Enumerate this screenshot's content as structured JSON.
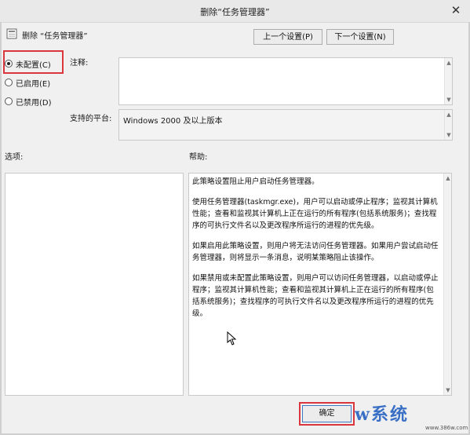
{
  "window": {
    "title": "删除“任务管理器”",
    "close_glyph": "✕"
  },
  "header": {
    "setting_title": "删除 “任务管理器”",
    "prev_button": "上一个设置(P)",
    "next_button": "下一个设置(N)"
  },
  "state": {
    "options": [
      {
        "label": "未配置(C)",
        "checked": true
      },
      {
        "label": "已启用(E)",
        "checked": false
      },
      {
        "label": "已禁用(D)",
        "checked": false
      }
    ]
  },
  "comment": {
    "label": "注释:",
    "value": ""
  },
  "platform": {
    "label": "支持的平台:",
    "value": "Windows 2000 及以上版本"
  },
  "options_panel": {
    "label": "选项:"
  },
  "help": {
    "label": "帮助:",
    "paragraphs": [
      "此策略设置阻止用户启动任务管理器。",
      "使用任务管理器(taskmgr.exe)，用户可以启动或停止程序；监视其计算机性能；查看和监视其计算机上正在运行的所有程序(包括系统服务)；查找程序的可执行文件名以及更改程序所运行的进程的优先级。",
      "如果启用此策略设置，则用户将无法访问任务管理器。如果用户尝试启动任务管理器，则将显示一条消息，说明某策略阻止该操作。",
      "如果禁用或未配置此策略设置，则用户可以访问任务管理器，以启动或停止程序；监视其计算机性能；查看和监视其计算机上正在运行的所有程序(包括系统服务)；查找程序的可执行文件名以及更改程序所运行的进程的优先级。"
    ]
  },
  "footer": {
    "ok_button": "确定"
  },
  "watermark": {
    "brand": "w系统",
    "url": "www.386w.com"
  },
  "colors": {
    "highlight": "#d9363e",
    "accent": "#3d78c4"
  }
}
